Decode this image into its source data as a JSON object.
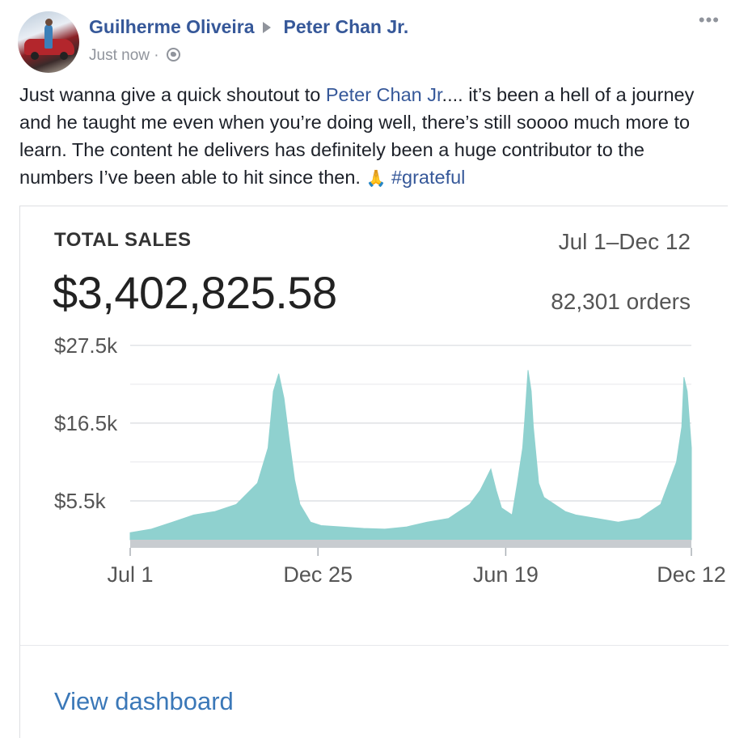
{
  "post": {
    "author": "Guilherme Oliveira",
    "recipient": "Peter Chan Jr.",
    "timestamp": "Just now",
    "separator": "·",
    "more_icon": "•••",
    "text_before": "Just wanna give a quick shoutout to ",
    "mention": "Peter Chan Jr",
    "text_after": ".... it’s been a hell of a journey and he taught me even when you’re doing well, there’s still soooo much more to learn. The content he delivers has definitely been a huge contributor to the numbers I’ve been able to hit since then. ",
    "emoji": "🙏",
    "hashtag": "#grateful"
  },
  "card": {
    "title": "TOTAL SALES",
    "total": "$3,402,825.58",
    "date_range": "Jul 1–Dec 12",
    "orders": "82,301 orders",
    "link": "View dashboard"
  },
  "chart_data": {
    "type": "area",
    "title": "TOTAL SALES",
    "y_tick_labels": [
      "$27.5k",
      "$16.5k",
      "$5.5k"
    ],
    "y_tick_values": [
      27500,
      16500,
      5500
    ],
    "x_tick_labels": [
      "Jul 1",
      "Dec 25",
      "Jun 19",
      "Dec 12"
    ],
    "x_tick_positions": [
      0,
      177,
      354,
      529
    ],
    "ylim": [
      0,
      30000
    ],
    "x_domain": [
      0,
      529
    ],
    "grid": true,
    "color": "#8fd1cf",
    "baseline_color": "#c8ccd0",
    "series": [
      {
        "x": [
          0,
          20,
          40,
          60,
          80,
          100,
          120,
          130,
          135,
          140,
          145,
          150,
          155,
          160,
          170,
          180,
          200,
          220,
          240,
          260,
          280,
          300,
          320,
          330,
          340,
          345,
          350,
          360,
          365,
          370,
          372,
          375,
          378,
          380,
          385,
          390,
          400,
          410,
          420,
          440,
          460,
          480,
          490,
          500,
          505,
          510,
          515,
          520,
          522,
          525,
          527,
          529
        ],
        "y": [
          1000,
          1500,
          2500,
          3500,
          4000,
          5000,
          8000,
          13000,
          21000,
          23500,
          20000,
          14000,
          8500,
          5000,
          2500,
          2000,
          1800,
          1600,
          1500,
          1800,
          2500,
          3000,
          5000,
          7000,
          10000,
          7000,
          4500,
          3500,
          8000,
          13000,
          17000,
          24000,
          21000,
          16000,
          8000,
          6000,
          5000,
          4000,
          3500,
          3000,
          2500,
          3000,
          4000,
          5000,
          7000,
          9000,
          11000,
          16000,
          23000,
          21000,
          17000,
          13000
        ]
      }
    ]
  }
}
